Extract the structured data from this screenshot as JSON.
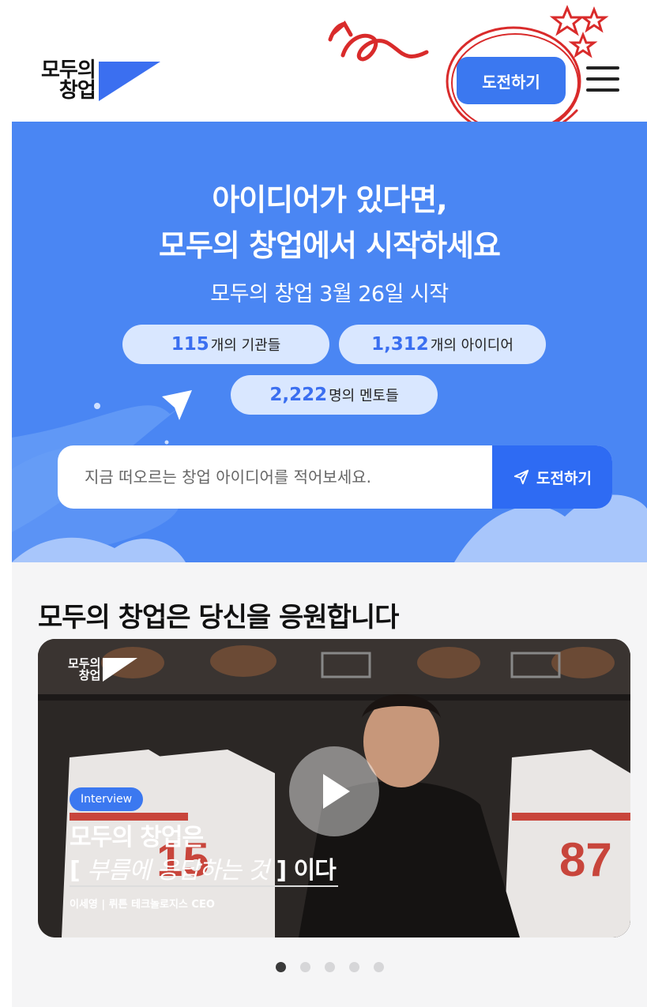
{
  "header": {
    "logo_line1": "모두의",
    "logo_line2": "창업",
    "cta_label": "도전하기"
  },
  "hero": {
    "title_line1": "아이디어가 있다면,",
    "title_line2": "모두의 창업에서 시작하세요",
    "subtitle": "모두의 창업 3월 26일 시작",
    "stats": [
      {
        "value": "115",
        "label": "개의 기관들"
      },
      {
        "value": "1,312",
        "label": "개의 아이디어"
      },
      {
        "value": "2,222",
        "label": "명의 멘토들"
      }
    ],
    "search_placeholder": "지금 떠오르는 창업 아이디어를 적어보세요.",
    "search_button": "도전하기"
  },
  "section": {
    "title": "모두의 창업은 당신을 응원합니다",
    "card": {
      "logo_line1": "모두의",
      "logo_line2": "창업",
      "badge": "Interview",
      "headline1": "모두의 창업은",
      "headline2_open": "[",
      "headline2_hand": "부름에 응답하는 것",
      "headline2_close": "] 이다",
      "caption": "이세영 | 뤼튼 테크놀로지스 CEO",
      "jersey_numbers": [
        "15",
        "87"
      ]
    },
    "carousel": {
      "count": 5,
      "active_index": 0
    }
  },
  "colors": {
    "brand_blue": "#3b78f0",
    "hero_bg": "#4a86f3",
    "annotation_red": "#d92b2b"
  }
}
